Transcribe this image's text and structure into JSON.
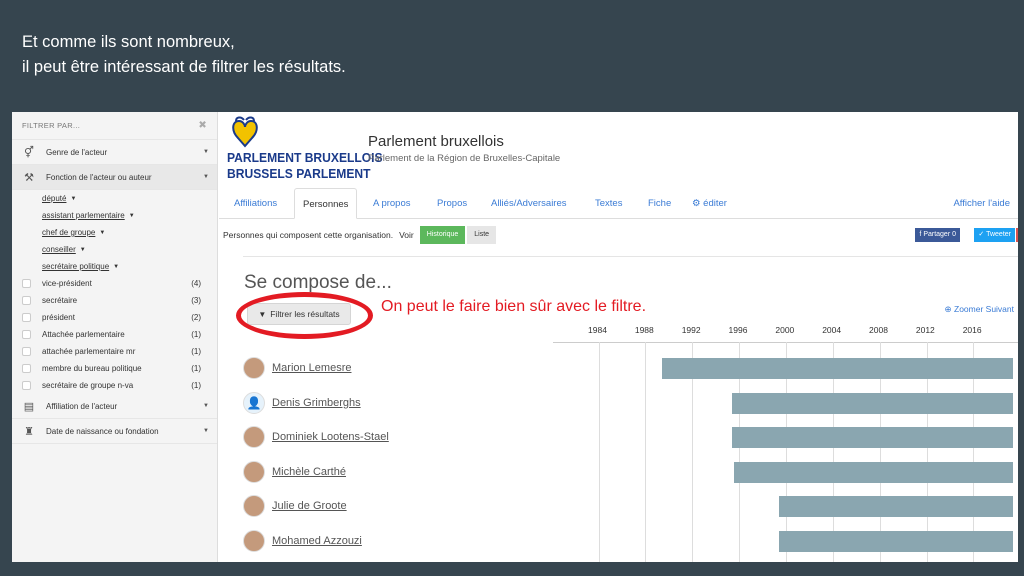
{
  "caption": {
    "line1": "Et comme ils sont nombreux,",
    "line2": "il peut être intéressant de filtrer les résultats."
  },
  "sidebar": {
    "header": "FILTRER PAR...",
    "close": "✖",
    "sections": [
      {
        "label": "Genre de l'acteur",
        "icon": "⚥"
      },
      {
        "label": "Fonction de l'acteur ou auteur",
        "icon": "⚒"
      },
      {
        "label": "Affiliation de l'acteur",
        "icon": "▤"
      },
      {
        "label": "Date de naissance ou fondation",
        "icon": "♜"
      }
    ],
    "subitems": [
      "député",
      "assistant parlementaire",
      "chef de groupe",
      "conseiller",
      "secrétaire politique"
    ],
    "checks": [
      {
        "label": "vice-président",
        "count": "(4)"
      },
      {
        "label": "secrétaire",
        "count": "(3)"
      },
      {
        "label": "président",
        "count": "(2)"
      },
      {
        "label": "Attachée parlementaire",
        "count": "(1)"
      },
      {
        "label": "attachée parlementaire mr",
        "count": "(1)"
      },
      {
        "label": "membre du bureau politique",
        "count": "(1)"
      },
      {
        "label": "secrétaire de groupe n-va",
        "count": "(1)"
      }
    ]
  },
  "logo": {
    "line1": "PARLEMENT BRUXELLOIS",
    "line2": "BRUSSELS PARLEMENT"
  },
  "org": {
    "title": "Parlement bruxellois",
    "subtitle": "Parlement de la Région de Bruxelles-Capitale"
  },
  "tabs": [
    "Affiliations",
    "Personnes",
    "A propos",
    "Propos",
    "Alliés/Adversaires",
    "Textes",
    "Fiche",
    "éditer",
    "Afficher l'aide"
  ],
  "toolbar": {
    "text": "Personnes qui composent cette organisation.",
    "voir": "Voir",
    "historique": "Historique",
    "liste": "Liste",
    "partager": "Partager 0",
    "tweeter": "Tweeter"
  },
  "compose": "Se compose de...",
  "filter_button": "Filtrer les résultats",
  "annotation": "On peut le faire bien sûr avec le filtre.",
  "zoom": "Zoomer  Suivant",
  "timeline": {
    "years": [
      "1984",
      "1988",
      "1992",
      "1996",
      "2000",
      "2004",
      "2008",
      "2012",
      "2016"
    ],
    "persons": [
      {
        "name": "Marion Lemesre",
        "start": 1989.5,
        "end": 2019.5
      },
      {
        "name": "Denis Grimberghs",
        "start": 1995.5,
        "end": 2019.5
      },
      {
        "name": "Dominiek Lootens-Stael",
        "start": 1995.5,
        "end": 2019.5
      },
      {
        "name": "Michèle Carthé",
        "start": 1995.7,
        "end": 2019.5
      },
      {
        "name": "Julie de Groote",
        "start": 1999.5,
        "end": 2019.5
      },
      {
        "name": "Mohamed Azzouzi",
        "start": 1999.5,
        "end": 2019.5
      }
    ]
  },
  "colors": {
    "bar": "#8aa6b0",
    "annotation": "#e31b23",
    "link": "#3a7bd5",
    "background": "#36454f"
  }
}
